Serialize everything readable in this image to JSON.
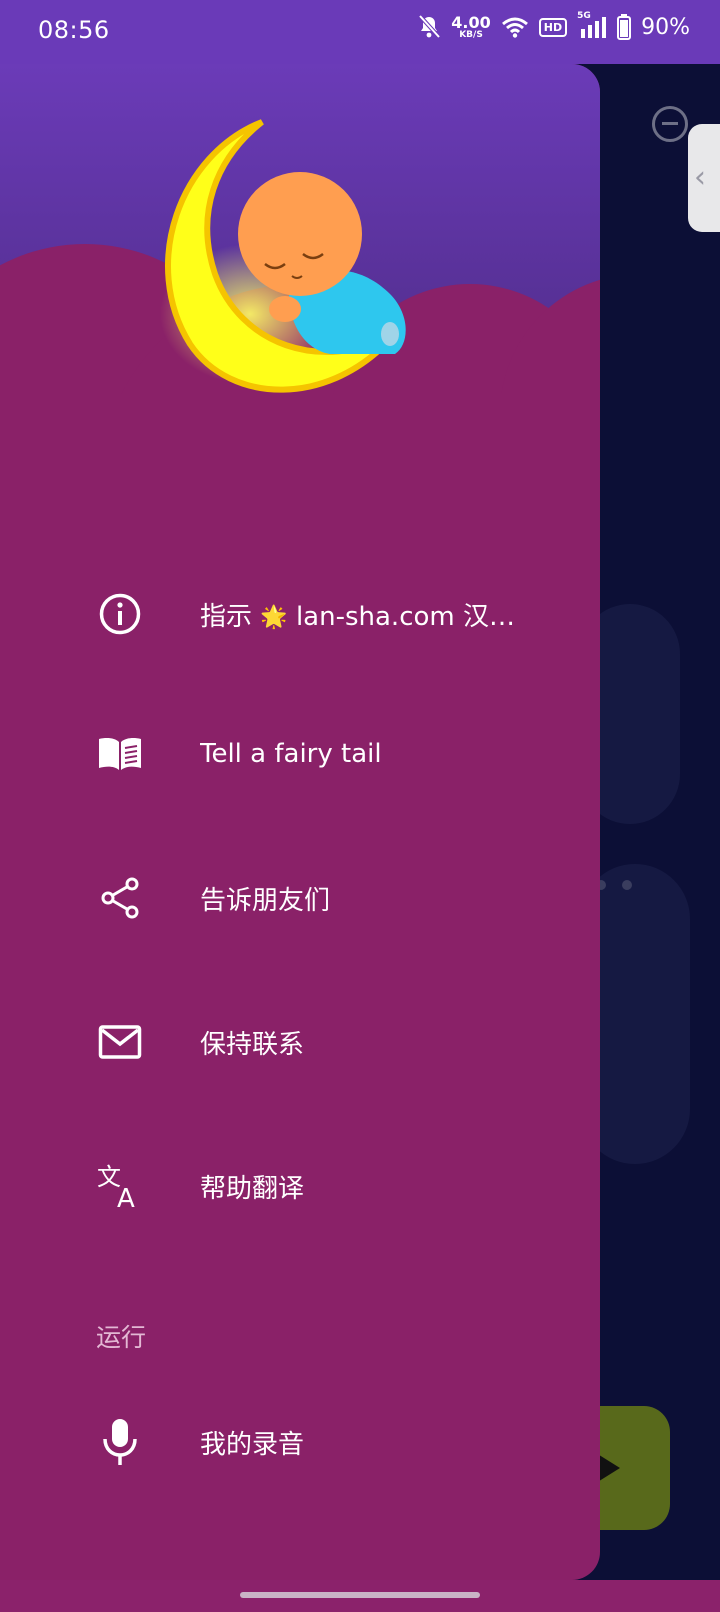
{
  "status_bar": {
    "time": "08:56",
    "net_speed": "4.00",
    "net_unit": "KB/S",
    "hd_badge": "HD",
    "signal_label": "5G",
    "battery_percent": "90%"
  },
  "drawer": {
    "items": [
      {
        "id": "instructions",
        "icon": "info-icon",
        "label_prefix": "指示",
        "label_star": "🌟",
        "label_suffix": "lan-sha.com 汉…"
      },
      {
        "id": "fairy_tale",
        "icon": "book-icon",
        "label": "Tell a fairy tail"
      },
      {
        "id": "share",
        "icon": "share-icon",
        "label": "告诉朋友们"
      },
      {
        "id": "contact",
        "icon": "mail-icon",
        "label": "保持联系"
      },
      {
        "id": "translate",
        "icon": "translate-icon",
        "label": "帮助翻译"
      }
    ],
    "section_title": "运行",
    "section_items": [
      {
        "id": "recordings",
        "icon": "microphone-icon",
        "label": "我的录音"
      }
    ]
  },
  "colors": {
    "drawer_bg": "#8a2168",
    "status_bar_bg": "#6a3ab8",
    "background_app": "#0c0f36",
    "play_button": "#58691b"
  }
}
